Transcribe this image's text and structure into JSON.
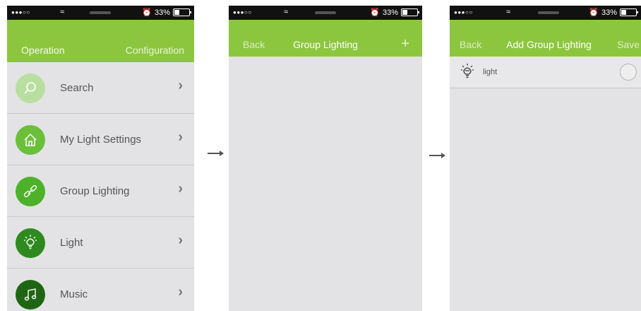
{
  "status": {
    "signal": "●●●○○",
    "battery": "33%"
  },
  "screen1": {
    "nav_left": "Operation",
    "nav_right": "Configuration",
    "items": [
      {
        "label": "Search",
        "icon": "search-icon",
        "color": "#b9dfa0"
      },
      {
        "label": "My Light Settings",
        "icon": "home-icon",
        "color": "#6cbf3a"
      },
      {
        "label": "Group Lighting",
        "icon": "link-icon",
        "color": "#4db22a"
      },
      {
        "label": "Light",
        "icon": "bulb-icon",
        "color": "#2e8a1f"
      },
      {
        "label": "Music",
        "icon": "music-icon",
        "color": "#1f6614"
      }
    ]
  },
  "screen2": {
    "back": "Back",
    "title": "Group Lighting",
    "add": "+"
  },
  "screen3": {
    "back": "Back",
    "title": "Add Group Lighting",
    "save": "Save",
    "rows": [
      {
        "label": "light"
      }
    ]
  },
  "colors": {
    "accent": "#8cc63f",
    "background": "#e3e3e6",
    "status_bar": "#111111"
  }
}
